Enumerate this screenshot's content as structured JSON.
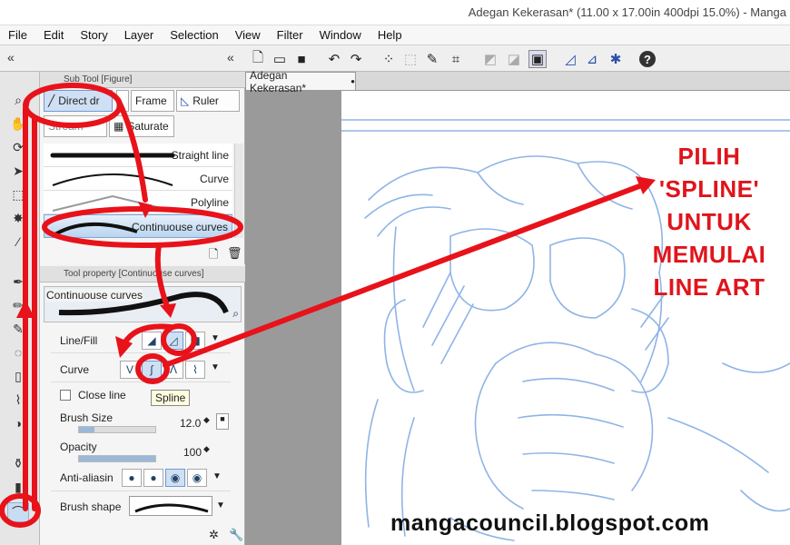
{
  "window": {
    "title": "Adegan Kekerasan* (11.00 x 17.00in 400dpi 15.0%) - Manga"
  },
  "menu": [
    "File",
    "Edit",
    "Story",
    "Layer",
    "Selection",
    "View",
    "Filter",
    "Window",
    "Help"
  ],
  "toolbar_icons": [
    "new-file-icon",
    "open-folder-icon",
    "save-icon",
    "undo-icon",
    "redo-icon",
    "dots-icon",
    "transform-icon",
    "pen-icon",
    "crop-icon",
    "grid-icon",
    "gradient-icon",
    "select-frame-icon",
    "ruler-icon",
    "angle-icon",
    "perspective-icon",
    "help-icon"
  ],
  "subtool": {
    "tab_label": "Sub Tool [Figure]",
    "buttons": {
      "direct_draw": "Direct dr",
      "frame": "Frame",
      "ruler": "Ruler",
      "saturate": "Saturate",
      "stream": "Stream"
    },
    "brushes": [
      "Straight line",
      "Curve",
      "Polyline",
      "Continuouse curves"
    ]
  },
  "toolprop": {
    "tab_label": "Tool property [Continuouse curves]",
    "preview_label": "Continuouse curves",
    "line_fill_label": "Line/Fill",
    "curve_label": "Curve",
    "tooltip": "Spline",
    "close_line_label": "Close line",
    "brush_size_label": "Brush Size",
    "brush_size_value": "12.0",
    "opacity_label": "Opacity",
    "opacity_value": "100",
    "anti_alias_label": "Anti-aliasin",
    "brush_shape_label": "Brush shape"
  },
  "canvas": {
    "tab_label": "Adegan Kekerasan*",
    "close_glyph": "●"
  },
  "annotation": {
    "lines": [
      "PILIH 'SPLINE'",
      "UNTUK",
      "MEMULAI",
      "LINE ART"
    ],
    "color": "#e0141b"
  },
  "watermark": "mangacouncil.blogspot.com"
}
